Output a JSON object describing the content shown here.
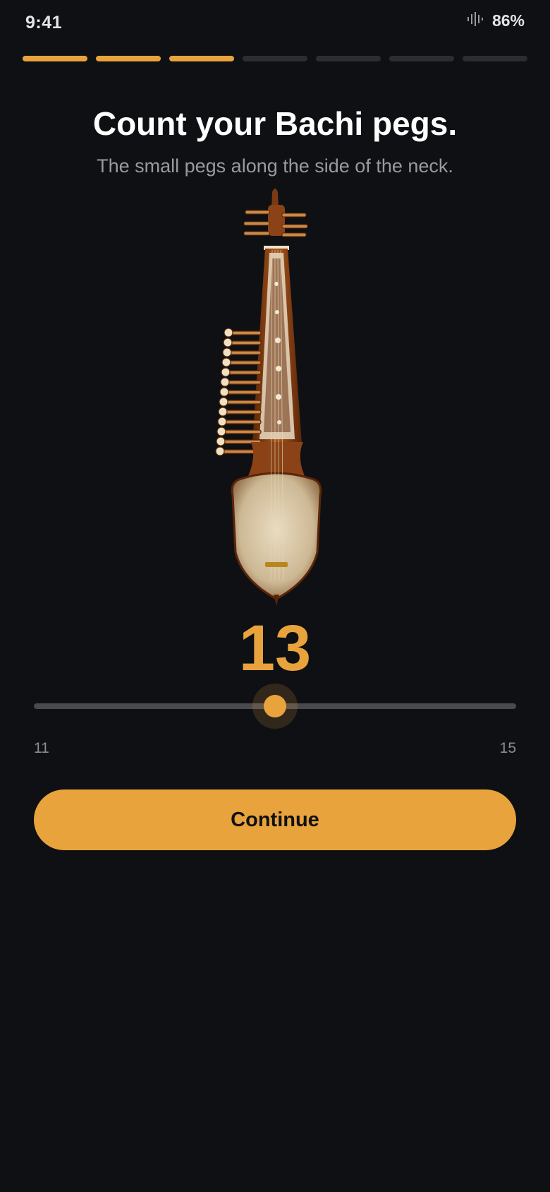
{
  "status_bar": {
    "time": "9:41",
    "battery": "86%",
    "signal_icon": "signal-bars-icon"
  },
  "progress": {
    "total_steps": 7,
    "completed_steps": 3,
    "accent_color": "#e9a33c",
    "inactive_color": "#2c2d31"
  },
  "page": {
    "title": "Count your Bachi pegs.",
    "subtitle": "The small pegs along the side of the neck."
  },
  "illustration": {
    "name": "rubab-instrument-image",
    "peg_count_shown": 13
  },
  "counter": {
    "value": "13",
    "numeric_value": 13,
    "min": 11,
    "max": 15,
    "min_label": "11",
    "max_label": "15"
  },
  "actions": {
    "continue_label": "Continue"
  },
  "colors": {
    "background": "#0f1014",
    "accent": "#e9a33c",
    "subtitle_text": "#9a9a9e"
  }
}
